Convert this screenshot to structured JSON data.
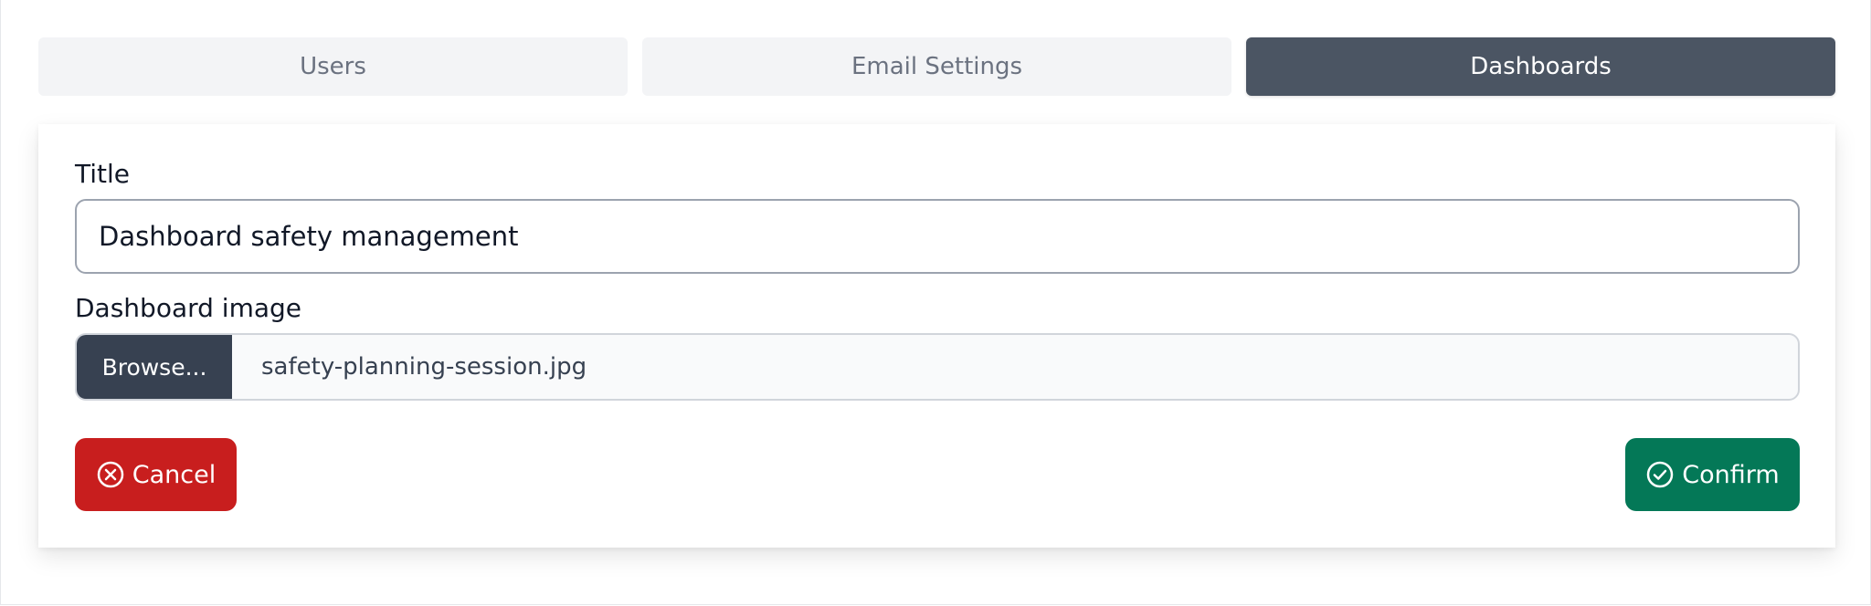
{
  "tabs": [
    {
      "label": "Users",
      "active": false
    },
    {
      "label": "Email Settings",
      "active": false
    },
    {
      "label": "Dashboards",
      "active": true
    }
  ],
  "form": {
    "title_label": "Title",
    "title_value": "Dashboard safety management",
    "image_label": "Dashboard image",
    "browse_label": "Browse...",
    "file_name": "safety-planning-session.jpg",
    "cancel_label": "Cancel",
    "confirm_label": "Confirm"
  },
  "icons": {
    "cancel": "x-circle-icon",
    "confirm": "check-circle-icon"
  },
  "colors": {
    "tab_active_bg": "#4b5563",
    "tab_inactive_bg": "#f3f4f6",
    "browse_bg": "#374151",
    "cancel_bg": "#c81e1e",
    "confirm_bg": "#047857"
  }
}
